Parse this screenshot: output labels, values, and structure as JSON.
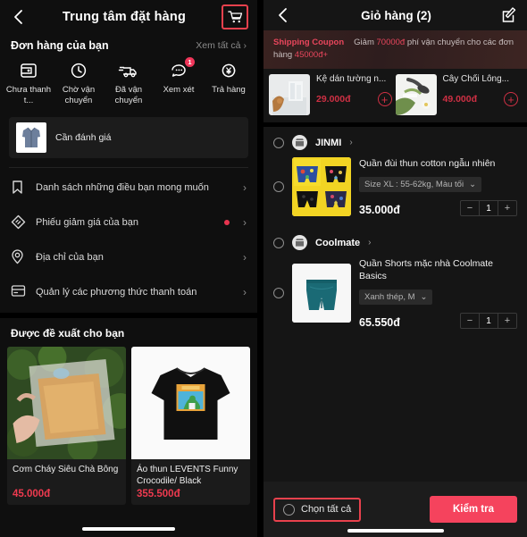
{
  "left": {
    "topbar": {
      "title": "Trung tâm đặt hàng",
      "back_icon": "chevron-left-icon",
      "cart_icon": "shopping-cart-icon"
    },
    "orders_section": {
      "title": "Đơn hàng của bạn",
      "view_all": "Xem tất cả"
    },
    "statuses": [
      {
        "label": "Chưa thanh t...",
        "icon": "wallet-icon",
        "badge": ""
      },
      {
        "label": "Chờ vận chuyển",
        "icon": "clock-icon",
        "badge": ""
      },
      {
        "label": "Đã vận chuyển",
        "icon": "truck-icon",
        "badge": ""
      },
      {
        "label": "Xem xét",
        "icon": "chat-bubble-icon",
        "badge": "1"
      },
      {
        "label": "Trả hàng",
        "icon": "refund-icon",
        "badge": ""
      }
    ],
    "review_card": {
      "text": "Cần đánh giá",
      "thumb": "jacket-thumbnail"
    },
    "menu": [
      {
        "label": "Danh sách những điều bạn mong muốn",
        "icon": "bookmark-icon",
        "dot": false
      },
      {
        "label": "Phiếu giảm giá của bạn",
        "icon": "coupon-tag-icon",
        "dot": true
      },
      {
        "label": "Địa chỉ của bạn",
        "icon": "location-pin-icon",
        "dot": false
      },
      {
        "label": "Quản lý các phương thức thanh toán",
        "icon": "credit-card-icon",
        "dot": false
      }
    ],
    "recommend": {
      "title": "Được đề xuất cho bạn",
      "products": [
        {
          "name": "Cơm Cháy Siêu Chà Bông",
          "price": "45.000đ",
          "image": "rice-crackers-photo"
        },
        {
          "name": "Áo thun LEVENTS Funny Crocodile/ Black",
          "price": "355.500đ",
          "image": "black-tshirt-photo"
        }
      ]
    }
  },
  "right": {
    "topbar": {
      "title": "Giỏ hàng (2)",
      "back_icon": "chevron-left-icon",
      "edit_icon": "edit-pencil-icon"
    },
    "coupon": {
      "tag": "Shipping Coupon",
      "text_before": "Giảm ",
      "amount": "70000đ",
      "text_middle": " phí vận chuyển cho các đơn hàng ",
      "threshold": "45000đ+"
    },
    "suggestions": [
      {
        "name": "Kệ dán tường n...",
        "price": "29.000đ",
        "add_icon": "plus-circle-icon",
        "image": "wall-shelf-photo"
      },
      {
        "name": "Cây Chổi Lông...",
        "price": "49.000đ",
        "add_icon": "plus-circle-icon",
        "image": "duster-photo"
      }
    ],
    "cart_groups": [
      {
        "shop": "JINMI",
        "shop_icon": "store-icon",
        "item": {
          "name": "Quần đùi thun cotton ngẫu nhiên",
          "variant": "Size XL : 55-62kg, Màu tối",
          "variant_chevron": "chevron-down-icon",
          "price": "35.000đ",
          "qty": "1",
          "minus": "−",
          "plus": "+",
          "image": "yellow-boxer-shorts-photo"
        }
      },
      {
        "shop": "Coolmate",
        "shop_icon": "store-icon",
        "item": {
          "name": "Quần Shorts mặc nhà Coolmate Basics",
          "variant": "Xanh thép, M",
          "variant_chevron": "chevron-down-icon",
          "price": "65.550đ",
          "qty": "1",
          "minus": "−",
          "plus": "+",
          "image": "teal-shorts-photo"
        }
      }
    ],
    "bottom": {
      "select_all": "Chọn tất cả",
      "checkout": "Kiểm tra"
    }
  },
  "colors": {
    "accent_red": "#e8414d",
    "checkout_red": "#f5435d",
    "price_red": "#ee3a4f",
    "badge_red": "#f0365a"
  }
}
